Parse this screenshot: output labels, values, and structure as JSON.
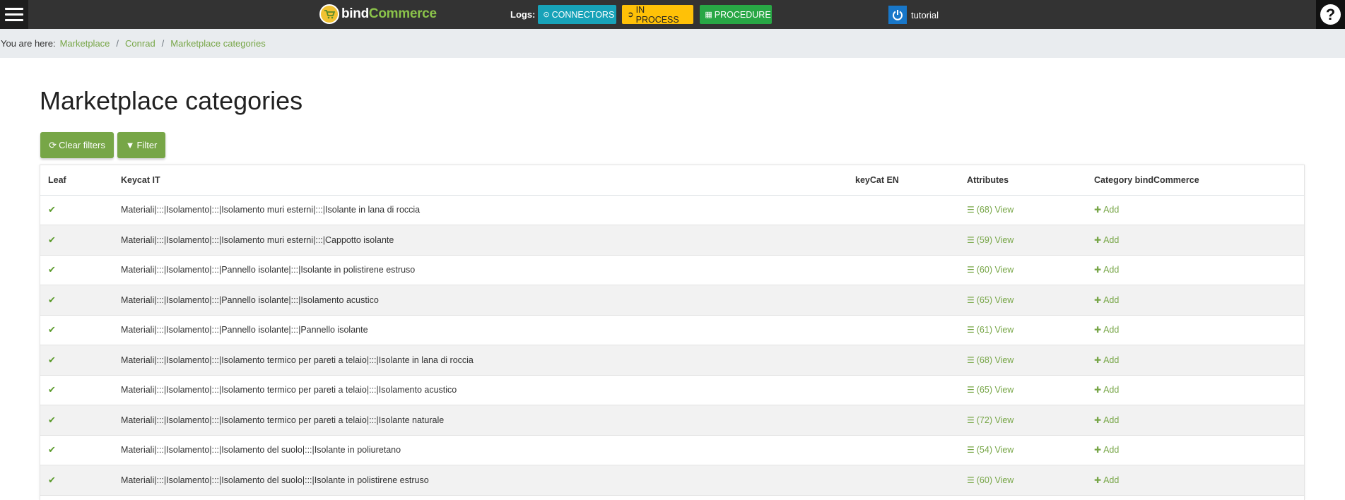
{
  "header": {
    "brand_part1": "bind",
    "brand_part2": "Commerce",
    "logs_label": "Logs:",
    "buttons": [
      {
        "icon": "arrow-circle-icon",
        "label": "CONNECTORS",
        "color": "#17a2b8"
      },
      {
        "icon": "arrow-circle-right-icon",
        "label": "IN PROCESS",
        "color": "#ffc107"
      },
      {
        "icon": "calendar-icon",
        "label": "PROCEDURE",
        "color": "#28a745"
      }
    ],
    "user_name": "tutorial",
    "help_glyph": "?"
  },
  "breadcrumb": {
    "prefix": "You are here:",
    "items": [
      "Marketplace",
      "Conrad",
      "Marketplace categories"
    ],
    "separator": "/"
  },
  "page_title": "Marketplace categories",
  "toolbar": {
    "clear_filters_label": "Clear filters",
    "filter_label": "Filter"
  },
  "table": {
    "columns": [
      "Leaf",
      "Keycat IT",
      "keyCat EN",
      "Attributes",
      "Category bindCommerce"
    ],
    "rows": [
      {
        "leaf": "✔",
        "keycat_it": "Materiali|:::|Isolamento|:::|Isolamento muri esterni|:::|Isolante in lana di roccia",
        "keycat_en": "",
        "attributes": "(68) View",
        "category": "Add"
      },
      {
        "leaf": "✔",
        "keycat_it": "Materiali|:::|Isolamento|:::|Isolamento muri esterni|:::|Cappotto isolante",
        "keycat_en": "",
        "attributes": "(59) View",
        "category": "Add"
      },
      {
        "leaf": "✔",
        "keycat_it": "Materiali|:::|Isolamento|:::|Pannello isolante|:::|Isolante in polistirene estruso",
        "keycat_en": "",
        "attributes": "(60) View",
        "category": "Add"
      },
      {
        "leaf": "✔",
        "keycat_it": "Materiali|:::|Isolamento|:::|Pannello isolante|:::|Isolamento acustico",
        "keycat_en": "",
        "attributes": "(65) View",
        "category": "Add"
      },
      {
        "leaf": "✔",
        "keycat_it": "Materiali|:::|Isolamento|:::|Pannello isolante|:::|Pannello isolante",
        "keycat_en": "",
        "attributes": "(61) View",
        "category": "Add"
      },
      {
        "leaf": "✔",
        "keycat_it": "Materiali|:::|Isolamento|:::|Isolamento termico per pareti a telaio|:::|Isolante in lana di roccia",
        "keycat_en": "",
        "attributes": "(68) View",
        "category": "Add"
      },
      {
        "leaf": "✔",
        "keycat_it": "Materiali|:::|Isolamento|:::|Isolamento termico per pareti a telaio|:::|Isolamento acustico",
        "keycat_en": "",
        "attributes": "(65) View",
        "category": "Add"
      },
      {
        "leaf": "✔",
        "keycat_it": "Materiali|:::|Isolamento|:::|Isolamento termico per pareti a telaio|:::|Isolante naturale",
        "keycat_en": "",
        "attributes": "(72) View",
        "category": "Add"
      },
      {
        "leaf": "✔",
        "keycat_it": "Materiali|:::|Isolamento|:::|Isolamento del suolo|:::|Isolante in poliuretano",
        "keycat_en": "",
        "attributes": "(54) View",
        "category": "Add"
      },
      {
        "leaf": "✔",
        "keycat_it": "Materiali|:::|Isolamento|:::|Isolamento del suolo|:::|Isolante in polistirene estruso",
        "keycat_en": "",
        "attributes": "(60) View",
        "category": "Add"
      }
    ]
  },
  "colors": {
    "accent": "#77a647",
    "topbar": "#333333",
    "breadcrumb_bg": "#e9ecef"
  }
}
